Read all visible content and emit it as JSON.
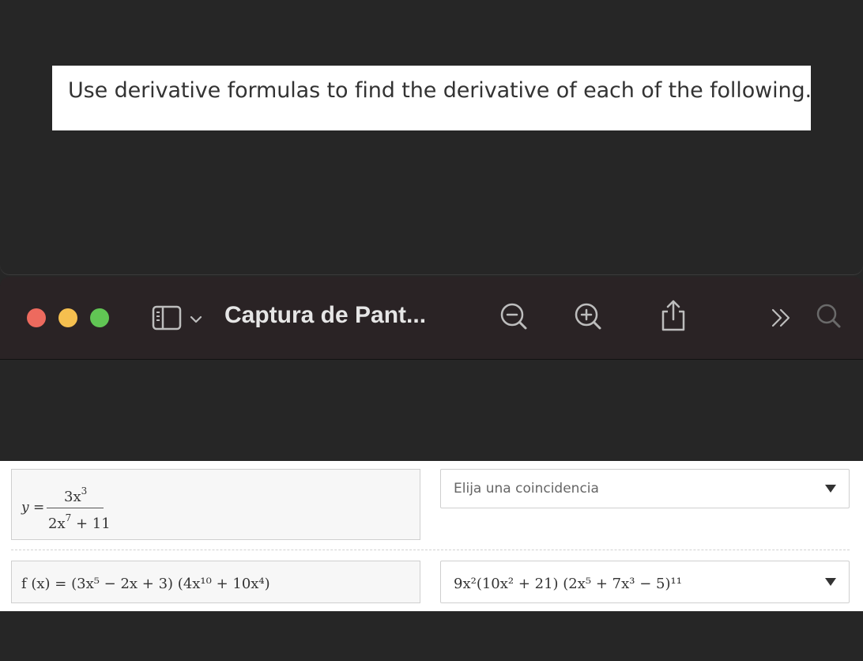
{
  "question": {
    "instruction": "Use derivative formulas to find the derivative of each of the following."
  },
  "window": {
    "title": "Captura de Pant..."
  },
  "colors": {
    "close": "#ed6a5e",
    "minimize": "#f5bf4f",
    "maximize": "#61c554",
    "toolbar_bg": "#2a2325",
    "page_bg": "#262626"
  },
  "icons": [
    "sidebar-icon",
    "chevron-down-icon",
    "zoom-out-icon",
    "zoom-in-icon",
    "share-icon",
    "chevron-double-right-icon",
    "search-icon"
  ],
  "items": [
    {
      "expression": {
        "lhs": "y =",
        "numerator": "3x",
        "numerator_exp": "3",
        "denominator": "2x",
        "denominator_exp": "7",
        "denominator_tail": "+ 11"
      },
      "selected": "Elija una coincidencia"
    },
    {
      "expression_text": "f (x) = (3x⁵ − 2x + 3) (4x¹⁰ + 10x⁴)",
      "selected_text": "9x²(10x² + 21) (2x⁵ + 7x³ − 5)¹¹"
    }
  ]
}
